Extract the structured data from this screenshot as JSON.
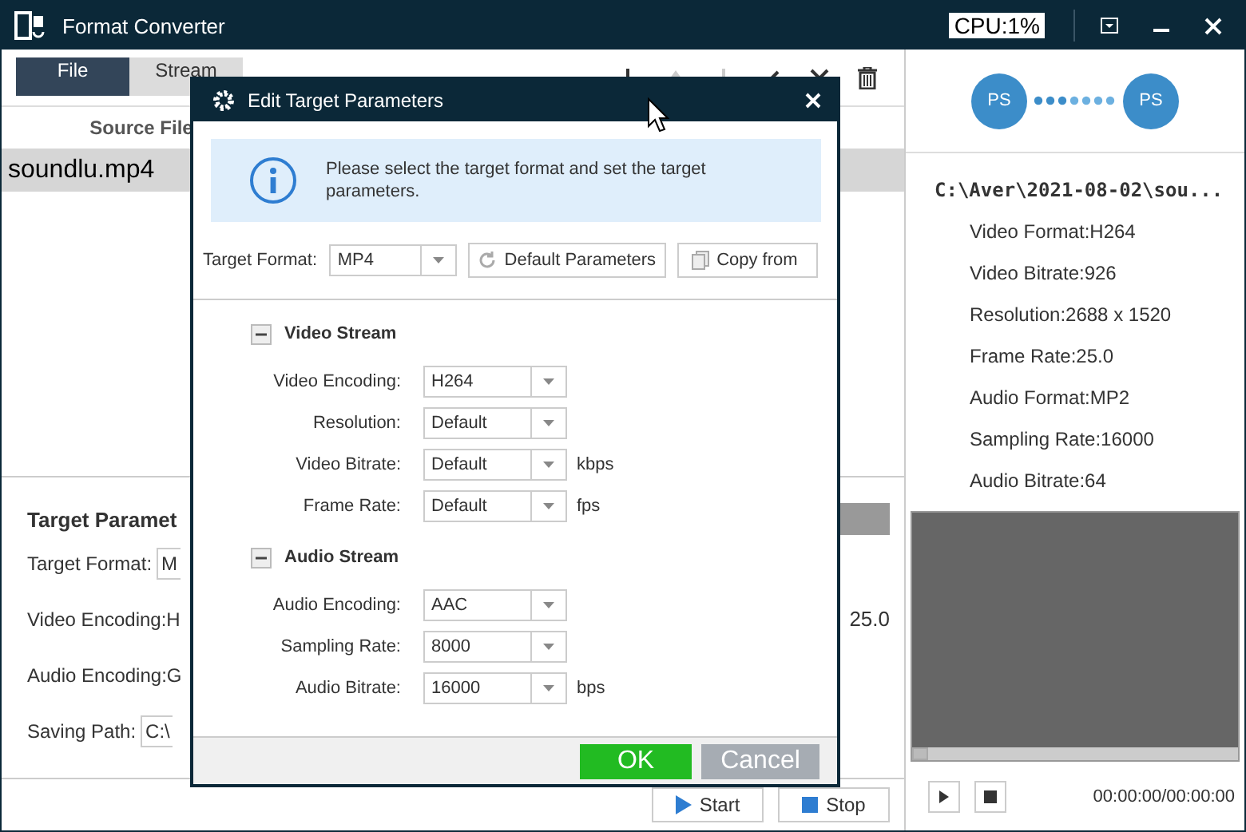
{
  "window": {
    "title": "Format Converter",
    "cpu": "CPU:1%"
  },
  "tabs": [
    {
      "label": "File",
      "selected": true
    },
    {
      "label": "Stream",
      "selected": false
    }
  ],
  "table": {
    "column_1": "Source File",
    "rows": [
      {
        "name": "soundlu.mp4",
        "selected": true
      }
    ]
  },
  "target_parameters": {
    "title": "Target Paramet",
    "format_label": "Target Format:",
    "format_value": "M",
    "video_encoding": "Video Encoding:H",
    "frame_rate": "25.0",
    "audio_encoding": "Audio Encoding:G",
    "saving_path_label": "Saving Path:",
    "saving_path_value": "C:\\"
  },
  "actions": [
    "Start",
    "Stop"
  ],
  "info_panel": {
    "source_badge": "PS",
    "target_badge": "PS",
    "path": "C:\\Aver\\2021-08-02\\sou...",
    "details": [
      "Video Format:H264",
      "Video Bitrate:926",
      "Resolution:2688 x 1520",
      "Frame Rate:25.0",
      "Audio Format:MP2",
      "Sampling Rate:16000",
      "Audio Bitrate:64"
    ],
    "time": "00:00:00/00:00:00"
  },
  "dialog": {
    "title": "Edit Target Parameters",
    "message": "Please select the target format and set the target parameters.",
    "format_label": "Target Format:",
    "format_value": "MP4",
    "buttons": [
      "Default Parameters",
      "Copy from"
    ],
    "sections": [
      {
        "title": "Video Stream",
        "expanded": true,
        "fields": [
          {
            "label": "Video Encoding:",
            "value": "H264"
          },
          {
            "label": "Resolution:",
            "value": "Default"
          },
          {
            "label": "Video Bitrate:",
            "value": "Default",
            "unit": "kbps"
          },
          {
            "label": "Frame Rate:",
            "value": "Default",
            "unit": "fps"
          }
        ]
      },
      {
        "title": "Audio Stream",
        "expanded": true,
        "fields": [
          {
            "label": "Audio Encoding:",
            "value": "AAC"
          },
          {
            "label": "Sampling Rate:",
            "value": "8000"
          },
          {
            "label": "Audio Bitrate:",
            "value": "16000",
            "unit": "bps"
          }
        ]
      }
    ],
    "ok": "OK",
    "cancel": "Cancel"
  }
}
